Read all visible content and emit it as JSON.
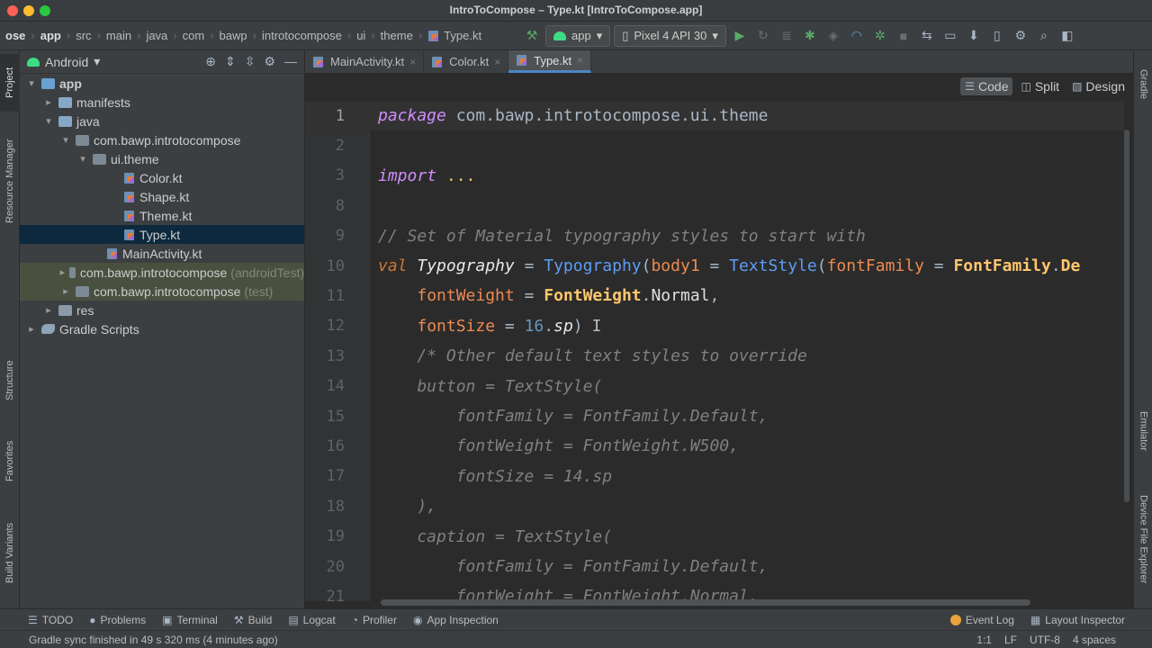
{
  "window": {
    "title": "IntroToCompose – Type.kt [IntroToCompose.app]"
  },
  "breadcrumb": [
    {
      "label": "ose",
      "bold": true
    },
    {
      "label": "app",
      "bold": true
    },
    {
      "label": "src",
      "bold": false
    },
    {
      "label": "main",
      "bold": false
    },
    {
      "label": "java",
      "bold": false
    },
    {
      "label": "com",
      "bold": false
    },
    {
      "label": "bawp",
      "bold": false
    },
    {
      "label": "introtocompose",
      "bold": false
    },
    {
      "label": "ui",
      "bold": false
    },
    {
      "label": "theme",
      "bold": false
    },
    {
      "label": "Type.kt",
      "bold": false,
      "icon": "kotlin-file-icon"
    }
  ],
  "toolbar": {
    "run_config": "app",
    "device": "Pixel 4 API 30"
  },
  "left_tool_windows": {
    "project": "Project",
    "resource_manager": "Resource Manager",
    "structure": "Structure",
    "favorites": "Favorites",
    "build_variants": "Build Variants"
  },
  "right_tool_windows": {
    "gradle": "Gradle",
    "emulator": "Emulator",
    "device_file_explorer": "Device File Explorer"
  },
  "project_panel": {
    "view_mode": "Android",
    "tree": [
      {
        "label": "app",
        "depth": 0,
        "arrow": "▾",
        "icon": "app-folder",
        "bold": true
      },
      {
        "label": "manifests",
        "depth": 1,
        "arrow": "▸",
        "icon": "folder"
      },
      {
        "label": "java",
        "depth": 1,
        "arrow": "▾",
        "icon": "folder"
      },
      {
        "label": "com.bawp.introtocompose",
        "depth": 2,
        "arrow": "▾",
        "icon": "package"
      },
      {
        "label": "ui.theme",
        "depth": 3,
        "arrow": "▾",
        "icon": "package"
      },
      {
        "label": "Color.kt",
        "depth": 5,
        "arrow": "",
        "icon": "kotlin-file"
      },
      {
        "label": "Shape.kt",
        "depth": 5,
        "arrow": "",
        "icon": "kotlin-file"
      },
      {
        "label": "Theme.kt",
        "depth": 5,
        "arrow": "",
        "icon": "kotlin-file"
      },
      {
        "label": "Type.kt",
        "depth": 5,
        "arrow": "",
        "icon": "kotlin-file",
        "selected": true
      },
      {
        "label": "MainActivity.kt",
        "depth": 4,
        "arrow": "",
        "icon": "kotlin-file"
      },
      {
        "label": "com.bawp.introtocompose",
        "suffix": "(androidTest)",
        "depth": 2,
        "arrow": "▸",
        "icon": "package",
        "module_bg": true
      },
      {
        "label": "com.bawp.introtocompose",
        "suffix": "(test)",
        "depth": 2,
        "arrow": "▸",
        "icon": "package",
        "module_bg": true
      },
      {
        "label": "res",
        "depth": 1,
        "arrow": "▸",
        "icon": "res-folder"
      },
      {
        "label": "Gradle Scripts",
        "depth": 0,
        "arrow": "▸",
        "icon": "gradle"
      }
    ]
  },
  "editor": {
    "tabs": [
      {
        "label": "MainActivity.kt",
        "active": false
      },
      {
        "label": "Color.kt",
        "active": false
      },
      {
        "label": "Type.kt",
        "active": true
      }
    ],
    "view_modes": [
      {
        "label": "Code",
        "active": true
      },
      {
        "label": "Split",
        "active": false
      },
      {
        "label": "Design",
        "active": false
      }
    ],
    "current_line": 1,
    "lines": [
      {
        "num": "1",
        "tokens": [
          [
            "kw-pkg",
            "package"
          ],
          [
            "plain",
            " com.bawp.introtocompose.ui.theme"
          ]
        ]
      },
      {
        "num": "2",
        "tokens": []
      },
      {
        "num": "3",
        "tokens": [
          [
            "kw-pkg",
            "import"
          ],
          [
            "plain",
            " "
          ],
          [
            "yellowdots",
            "..."
          ]
        ]
      },
      {
        "num": "8",
        "tokens": []
      },
      {
        "num": "9",
        "tokens": [
          [
            "comment",
            "// Set of Material typography styles to start with"
          ]
        ]
      },
      {
        "num": "10",
        "tokens": [
          [
            "kwi",
            "val"
          ],
          [
            "plain",
            " "
          ],
          [
            "ital-name",
            "Typography"
          ],
          [
            "plain",
            " = "
          ],
          [
            "fn",
            "Typography"
          ],
          [
            "plain",
            "("
          ],
          [
            "param",
            "body1"
          ],
          [
            "plain",
            " = "
          ],
          [
            "fn",
            "TextStyle"
          ],
          [
            "plain",
            "("
          ],
          [
            "param",
            "fontFamily"
          ],
          [
            "plain",
            " = "
          ],
          [
            "cls",
            "FontFamily"
          ],
          [
            "plain",
            "."
          ],
          [
            "cls",
            "De"
          ]
        ]
      },
      {
        "num": "11",
        "tokens": [
          [
            "plain",
            "    "
          ],
          [
            "param",
            "fontWeight"
          ],
          [
            "plain",
            " = "
          ],
          [
            "cls",
            "FontWeight"
          ],
          [
            "plain",
            "."
          ],
          [
            "field",
            "Normal"
          ],
          [
            "plain",
            ","
          ]
        ]
      },
      {
        "num": "12",
        "tokens": [
          [
            "plain",
            "    "
          ],
          [
            "param",
            "fontSize"
          ],
          [
            "plain",
            " = "
          ],
          [
            "num",
            "16"
          ],
          [
            "plain",
            "."
          ],
          [
            "ital-name",
            "sp"
          ],
          [
            "plain",
            ")"
          ],
          [
            "cursor",
            "I"
          ]
        ]
      },
      {
        "num": "13",
        "tokens": [
          [
            "plain",
            "    "
          ],
          [
            "comment",
            "/* Other default text styles to override"
          ]
        ]
      },
      {
        "num": "14",
        "tokens": [
          [
            "comment",
            "    button = TextStyle("
          ]
        ]
      },
      {
        "num": "15",
        "tokens": [
          [
            "comment",
            "        fontFamily = FontFamily.Default,"
          ]
        ]
      },
      {
        "num": "16",
        "tokens": [
          [
            "comment",
            "        fontWeight = FontWeight.W500,"
          ]
        ]
      },
      {
        "num": "17",
        "tokens": [
          [
            "comment",
            "        fontSize = 14.sp"
          ]
        ]
      },
      {
        "num": "18",
        "tokens": [
          [
            "comment",
            "    ),"
          ]
        ]
      },
      {
        "num": "19",
        "tokens": [
          [
            "comment",
            "    caption = TextStyle("
          ]
        ]
      },
      {
        "num": "20",
        "tokens": [
          [
            "comment",
            "        fontFamily = FontFamily.Default,"
          ]
        ]
      },
      {
        "num": "21",
        "tokens": [
          [
            "comment",
            "        fontWeight = FontWeight.Normal,"
          ]
        ]
      }
    ]
  },
  "bottom_tools": {
    "left": [
      {
        "label": "TODO",
        "icon": "list-icon",
        "glyph": "☰"
      },
      {
        "label": "Problems",
        "icon": "problems-icon",
        "glyph": "●"
      },
      {
        "label": "Terminal",
        "icon": "terminal-icon",
        "glyph": "▣"
      },
      {
        "label": "Build",
        "icon": "hammer-icon",
        "glyph": "⚒"
      },
      {
        "label": "Logcat",
        "icon": "logcat-icon",
        "glyph": "▤"
      },
      {
        "label": "Profiler",
        "icon": "profiler-icon",
        "glyph": "◔"
      },
      {
        "label": "App Inspection",
        "icon": "inspection-icon",
        "glyph": "◉"
      }
    ],
    "right": [
      {
        "label": "Event Log",
        "icon": "event-log-icon"
      },
      {
        "label": "Layout Inspector",
        "icon": "layout-inspector-icon"
      }
    ]
  },
  "status_bar": {
    "message": "Gradle sync finished in 49 s 320 ms (4 minutes ago)",
    "position": "1:1",
    "line_sep": "LF",
    "encoding": "UTF-8",
    "indent": "4 spaces"
  },
  "colors": {
    "keyword": "#cf8dfb",
    "function": "#5f9cf5",
    "parameter": "#ee8a51",
    "class": "#ffc66d",
    "comment": "#808080",
    "number": "#6897bb",
    "selection": "#0d293e"
  }
}
